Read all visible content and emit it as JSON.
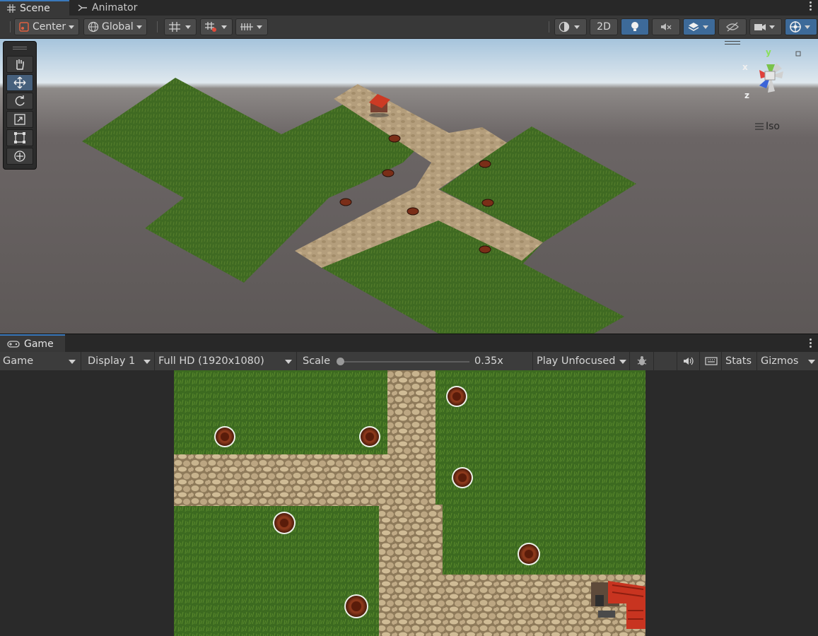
{
  "scene_tabs": [
    {
      "label": "Scene",
      "icon": "grid-icon",
      "active": true
    },
    {
      "label": "Animator",
      "icon": "animator-icon",
      "active": false
    }
  ],
  "scene_toolbar": {
    "pivot_label": "Center",
    "space_label": "Global",
    "mode_2d_label": "2D"
  },
  "scene_view": {
    "projection_label": "Iso",
    "gizmo_axes": {
      "x": "x",
      "y": "y",
      "z": "z"
    }
  },
  "game_tab": {
    "label": "Game",
    "icon": "gamepad-icon"
  },
  "game_toolbar": {
    "view_select": "Game",
    "display_select": "Display 1",
    "resolution_select": "Full HD (1920x1080)",
    "scale_label": "Scale",
    "scale_value": "0.35x",
    "scale_fraction": 0.0,
    "play_mode_select": "Play Unfocused",
    "stats_label": "Stats",
    "gizmos_label": "Gizmos"
  },
  "colors": {
    "grass": "#3e6a22",
    "path": "#b09a76",
    "turret": "#7a2e18",
    "accent_blue": "#3d6a99",
    "house_roof": "#c8321e"
  }
}
